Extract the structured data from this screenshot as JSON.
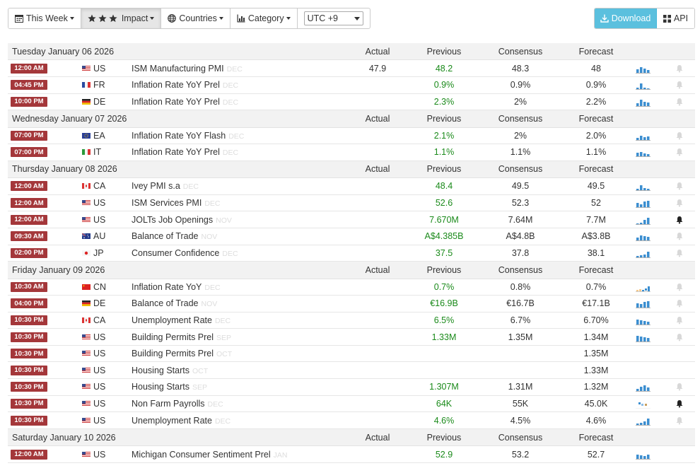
{
  "toolbar": {
    "this_week": "This Week",
    "impact": "Impact",
    "countries": "Countries",
    "category": "Category",
    "timezone": "UTC +9",
    "download": "Download",
    "api": "API"
  },
  "columns": {
    "actual": "Actual",
    "previous": "Previous",
    "consensus": "Consensus",
    "forecast": "Forecast"
  },
  "colors": {
    "time_badge": "#a4373a",
    "previous_green": "#1a8a1a",
    "spark_blue": "#3b8ed0",
    "download_bg": "#5bc0de"
  },
  "groups": [
    {
      "date": "Tuesday January 06 2026",
      "events": [
        {
          "time": "12:00 AM",
          "country": "US",
          "event": "ISM Manufacturing PMI",
          "ref": "DEC",
          "actual": "47.9",
          "previous": "48.2",
          "consensus": "48.3",
          "forecast": "48",
          "spark": "bars",
          "bell": "off"
        },
        {
          "time": "04:45 PM",
          "country": "FR",
          "event": "Inflation Rate YoY Prel",
          "ref": "DEC",
          "actual": "",
          "previous": "0.9%",
          "consensus": "0.9%",
          "forecast": "0.9%",
          "spark": "bars",
          "bell": "off"
        },
        {
          "time": "10:00 PM",
          "country": "DE",
          "event": "Inflation Rate YoY Prel",
          "ref": "DEC",
          "actual": "",
          "previous": "2.3%",
          "consensus": "2%",
          "forecast": "2.2%",
          "spark": "bars",
          "bell": "off"
        }
      ]
    },
    {
      "date": "Wednesday January 07 2026",
      "events": [
        {
          "time": "07:00 PM",
          "country": "EA",
          "event": "Inflation Rate YoY Flash",
          "ref": "DEC",
          "actual": "",
          "previous": "2.1%",
          "consensus": "2%",
          "forecast": "2.0%",
          "spark": "bars",
          "bell": "off"
        },
        {
          "time": "07:00 PM",
          "country": "IT",
          "event": "Inflation Rate YoY Prel",
          "ref": "DEC",
          "actual": "",
          "previous": "1.1%",
          "consensus": "1.1%",
          "forecast": "1.1%",
          "spark": "bars",
          "bell": "off"
        }
      ]
    },
    {
      "date": "Thursday January 08 2026",
      "events": [
        {
          "time": "12:00 AM",
          "country": "CA",
          "event": "Ivey PMI s.a",
          "ref": "DEC",
          "actual": "",
          "previous": "48.4",
          "consensus": "49.5",
          "forecast": "49.5",
          "spark": "bars",
          "bell": "off"
        },
        {
          "time": "12:00 AM",
          "country": "US",
          "event": "ISM Services PMI",
          "ref": "DEC",
          "actual": "",
          "previous": "52.6",
          "consensus": "52.3",
          "forecast": "52",
          "spark": "bars",
          "bell": "off"
        },
        {
          "time": "12:00 AM",
          "country": "US",
          "event": "JOLTs Job Openings",
          "ref": "NOV",
          "actual": "",
          "previous": "7.670M",
          "consensus": "7.64M",
          "forecast": "7.7M",
          "spark": "bars",
          "bell": "on"
        },
        {
          "time": "09:30 AM",
          "country": "AU",
          "event": "Balance of Trade",
          "ref": "NOV",
          "actual": "",
          "previous": "A$4.385B",
          "consensus": "A$4.8B",
          "forecast": "A$3.8B",
          "spark": "bars",
          "bell": "off"
        },
        {
          "time": "02:00 PM",
          "country": "JP",
          "event": "Consumer Confidence",
          "ref": "DEC",
          "actual": "",
          "previous": "37.5",
          "consensus": "37.8",
          "forecast": "38.1",
          "spark": "bars",
          "bell": "off"
        }
      ]
    },
    {
      "date": "Friday January 09 2026",
      "events": [
        {
          "time": "10:30 AM",
          "country": "CN",
          "event": "Inflation Rate YoY",
          "ref": "DEC",
          "actual": "",
          "previous": "0.7%",
          "consensus": "0.8%",
          "forecast": "0.7%",
          "spark": "mixed",
          "bell": "off"
        },
        {
          "time": "04:00 PM",
          "country": "DE",
          "event": "Balance of Trade",
          "ref": "NOV",
          "actual": "",
          "previous": "€16.9B",
          "consensus": "€16.7B",
          "forecast": "€17.1B",
          "spark": "bars",
          "bell": "off"
        },
        {
          "time": "10:30 PM",
          "country": "CA",
          "event": "Unemployment Rate",
          "ref": "DEC",
          "actual": "",
          "previous": "6.5%",
          "consensus": "6.7%",
          "forecast": "6.70%",
          "spark": "bars",
          "bell": "off"
        },
        {
          "time": "10:30 PM",
          "country": "US",
          "event": "Building Permits Prel",
          "ref": "SEP",
          "actual": "",
          "previous": "1.33M",
          "consensus": "1.35M",
          "forecast": "1.34M",
          "spark": "bars",
          "bell": "off"
        },
        {
          "time": "10:30 PM",
          "country": "US",
          "event": "Building Permits Prel",
          "ref": "OCT",
          "actual": "",
          "previous": "",
          "consensus": "",
          "forecast": "1.35M",
          "spark": "none",
          "bell": "none"
        },
        {
          "time": "10:30 PM",
          "country": "US",
          "event": "Housing Starts",
          "ref": "OCT",
          "actual": "",
          "previous": "",
          "consensus": "",
          "forecast": "1.33M",
          "spark": "none",
          "bell": "none"
        },
        {
          "time": "10:30 PM",
          "country": "US",
          "event": "Housing Starts",
          "ref": "SEP",
          "actual": "",
          "previous": "1.307M",
          "consensus": "1.31M",
          "forecast": "1.32M",
          "spark": "bars",
          "bell": "off"
        },
        {
          "time": "10:30 PM",
          "country": "US",
          "event": "Non Farm Payrolls",
          "ref": "DEC",
          "actual": "",
          "previous": "64K",
          "consensus": "55K",
          "forecast": "45.0K",
          "spark": "dots",
          "bell": "on"
        },
        {
          "time": "10:30 PM",
          "country": "US",
          "event": "Unemployment Rate",
          "ref": "DEC",
          "actual": "",
          "previous": "4.6%",
          "consensus": "4.5%",
          "forecast": "4.6%",
          "spark": "bars",
          "bell": "off"
        }
      ]
    },
    {
      "date": "Saturday January 10 2026",
      "events": [
        {
          "time": "12:00 AM",
          "country": "US",
          "event": "Michigan Consumer Sentiment Prel",
          "ref": "JAN",
          "actual": "",
          "previous": "52.9",
          "consensus": "53.2",
          "forecast": "52.7",
          "spark": "bars",
          "bell": "none"
        }
      ]
    }
  ]
}
